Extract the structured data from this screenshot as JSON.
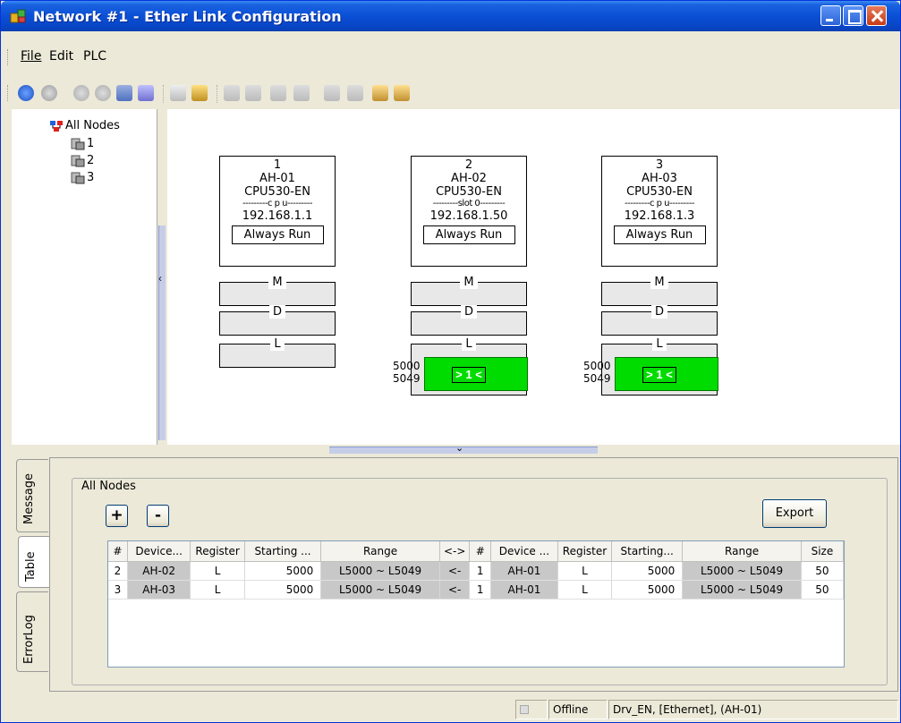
{
  "window": {
    "title": "Network #1 - Ether Link Configuration"
  },
  "colors": {
    "titlebar": "#0a4fd6",
    "link_block": "#00dc00",
    "selected_tab": "#ffffff"
  },
  "menu": [
    {
      "label": "File"
    },
    {
      "label": "Edit"
    },
    {
      "label": "PLC"
    }
  ],
  "toolbar": {
    "icons": [
      "online-icon",
      "offline-icon",
      "upload-icon",
      "download-icon",
      "monitor-icon",
      "scan-icon",
      "undo-icon",
      "wand-icon",
      "align-left-icon",
      "align-center-icon",
      "align-right-icon",
      "distribute-icon",
      "copy-icon",
      "paste-icon",
      "import-icon",
      "export-icon"
    ]
  },
  "tree": {
    "root": "All Nodes",
    "nodes": [
      {
        "label": "1"
      },
      {
        "label": "2"
      },
      {
        "label": "3"
      }
    ]
  },
  "canvas": {
    "nodes": [
      {
        "number": "1",
        "name": "AH-01",
        "cpu": "CPU530-EN",
        "sep": "---------c p u---------",
        "ip": "192.168.1.1",
        "mode": "Always Run",
        "areas": [
          "M",
          "D",
          "L"
        ]
      },
      {
        "number": "2",
        "name": "AH-02",
        "cpu": "CPU530-EN",
        "sep": "---------slot 0---------",
        "ip": "192.168.1.50",
        "mode": "Always Run",
        "areas": [
          "M",
          "D",
          "L"
        ],
        "link": {
          "start": "5000",
          "end": "5049",
          "label": "> 1 <"
        }
      },
      {
        "number": "3",
        "name": "AH-03",
        "cpu": "CPU530-EN",
        "sep": "---------c p u---------",
        "ip": "192.168.1.3",
        "mode": "Always Run",
        "areas": [
          "M",
          "D",
          "L"
        ],
        "link": {
          "start": "5000",
          "end": "5049",
          "label": "> 1 <"
        }
      }
    ]
  },
  "side_tabs": [
    {
      "label": "Message",
      "active": false
    },
    {
      "label": "Table",
      "active": true
    },
    {
      "label": "ErrorLog",
      "active": false
    }
  ],
  "table_panel": {
    "group_label": "All Nodes",
    "add_label": "+",
    "remove_label": "-",
    "export_label": "Export",
    "columns": [
      "#",
      "Device...",
      "Register",
      "Starting ...",
      "Range",
      "<->",
      "#",
      "Device ...",
      "Register",
      "Starting...",
      "Range",
      "Size"
    ],
    "rows": [
      [
        "2",
        "AH-02",
        "L",
        "5000",
        "L5000 ~ L5049",
        "<-",
        "1",
        "AH-01",
        "L",
        "5000",
        "L5000 ~ L5049",
        "50"
      ],
      [
        "3",
        "AH-03",
        "L",
        "5000",
        "L5000 ~ L5049",
        "<-",
        "1",
        "AH-01",
        "L",
        "5000",
        "L5000 ~ L5049",
        "50"
      ]
    ]
  },
  "status": {
    "mode": "Offline",
    "driver": "Drv_EN, [Ethernet], (AH-01)"
  }
}
